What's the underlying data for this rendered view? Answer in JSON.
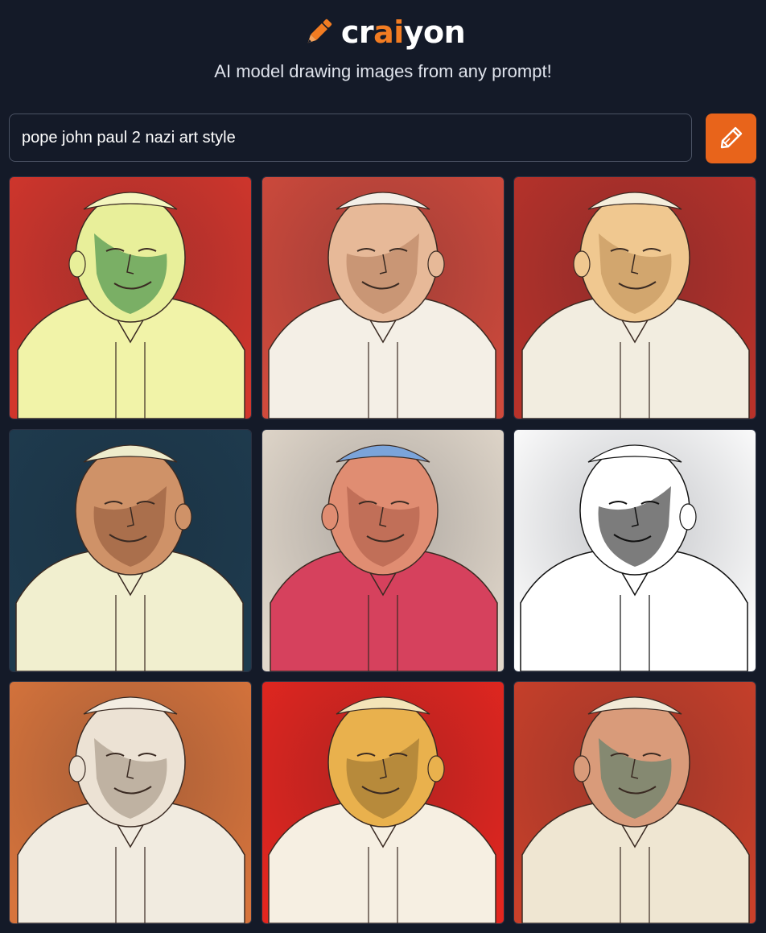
{
  "header": {
    "logo_parts": [
      "cr",
      "ai",
      "yon"
    ],
    "tagline": "AI model drawing images from any prompt!",
    "accent_color": "#f27c22"
  },
  "search": {
    "value": "pope john paul 2 nazi art style",
    "button_icon": "pencil-icon",
    "button_color": "#e8641b"
  },
  "results": {
    "count": 9,
    "images": [
      {
        "palette": {
          "bg": "#d2362c",
          "skin": "#e8ef9a",
          "shade": "#1f7a3a",
          "robe": "#f1f3a8",
          "cap": "#f4f6c0"
        }
      },
      {
        "palette": {
          "bg": "#cf4a3c",
          "skin": "#e7b998",
          "shade": "#b07a5a",
          "robe": "#f4efe6",
          "cap": "#f3efe8"
        }
      },
      {
        "palette": {
          "bg": "#b8322a",
          "skin": "#f0c890",
          "shade": "#b98a52",
          "robe": "#f2ede0",
          "cap": "#f5eedc"
        }
      },
      {
        "palette": {
          "bg": "#1e3b4e",
          "skin": "#cf9268",
          "shade": "#8c5234",
          "robe": "#f1efcf",
          "cap": "#eeeccc"
        }
      },
      {
        "palette": {
          "bg": "#e2d8cb",
          "skin": "#e08d72",
          "shade": "#a85844",
          "robe": "#d6415d",
          "cap": "#7ba4da"
        }
      },
      {
        "palette": {
          "bg": "#ffffff",
          "skin": "#ffffff",
          "shade": "#111111",
          "robe": "#ffffff",
          "cap": "#ffffff"
        }
      },
      {
        "palette": {
          "bg": "#d7743c",
          "skin": "#ece2d4",
          "shade": "#9a8a78",
          "robe": "#f1ebe0",
          "cap": "#f3ede2"
        }
      },
      {
        "palette": {
          "bg": "#e3261f",
          "skin": "#e9b14d",
          "shade": "#8e6a2e",
          "robe": "#f6efe2",
          "cap": "#f3e4b8"
        }
      },
      {
        "palette": {
          "bg": "#c9402a",
          "skin": "#d99b7a",
          "shade": "#3f7a6a",
          "robe": "#efe6d2",
          "cap": "#f1ead8"
        }
      }
    ]
  }
}
